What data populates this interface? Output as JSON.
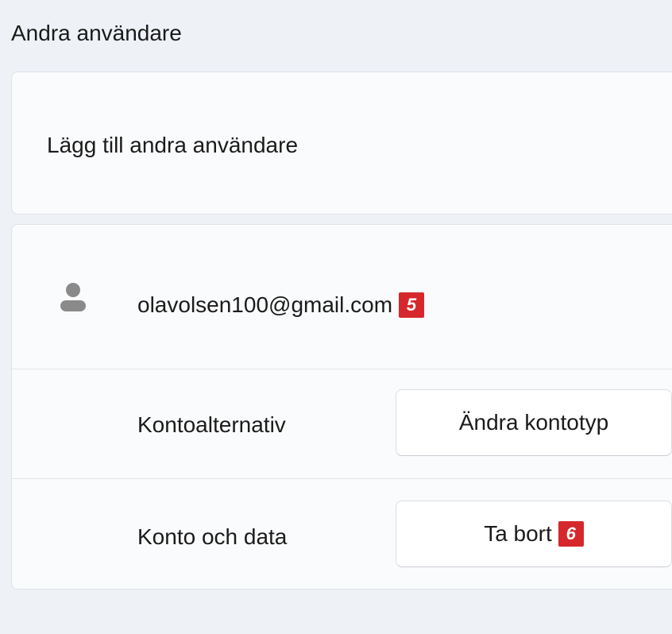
{
  "section": {
    "title": "Andra användare"
  },
  "add_user": {
    "label": "Lägg till andra användare"
  },
  "user": {
    "email": "olavolsen100@gmail.com",
    "email_badge": "5",
    "avatar_icon": "person-icon"
  },
  "account_options": {
    "label": "Kontoalternativ",
    "button_label": "Ändra kontotyp"
  },
  "account_data": {
    "label": "Konto och data",
    "button_label": "Ta bort",
    "button_badge": "6"
  },
  "colors": {
    "badge": "#d6282c",
    "background": "#eef2f7",
    "card": "#fafbfc"
  }
}
